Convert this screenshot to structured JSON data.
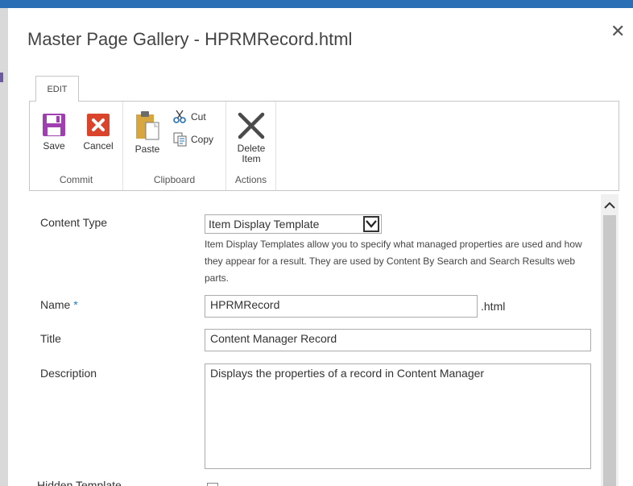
{
  "dialog": {
    "title": "Master Page Gallery - HPRMRecord.html",
    "close_glyph": "✕"
  },
  "ribbon": {
    "tab": "EDIT",
    "groups": {
      "commit": {
        "label": "Commit",
        "save": "Save",
        "cancel": "Cancel"
      },
      "clipboard": {
        "label": "Clipboard",
        "paste": "Paste",
        "cut": "Cut",
        "copy": "Copy"
      },
      "actions": {
        "label": "Actions",
        "delete_line1": "Delete",
        "delete_line2": "Item"
      }
    },
    "icons": {
      "save": "save-icon",
      "cancel": "cancel-icon",
      "paste": "paste-icon",
      "cut": "scissors-icon",
      "copy": "copy-icon",
      "delete": "delete-x-icon"
    },
    "colors": {
      "save": "#a040b0",
      "cancel": "#d9442b",
      "paste": "#d8a63e",
      "delete": "#4a4a4a"
    }
  },
  "form": {
    "content_type": {
      "label": "Content Type",
      "value": "Item Display Template",
      "help": "Item Display Templates allow you to specify what managed properties are used and how they appear for a result.  They are used by Content By Search and Search Results web parts."
    },
    "name": {
      "label": "Name",
      "required_marker": "*",
      "value": "HPRMRecord",
      "suffix": ".html"
    },
    "title": {
      "label": "Title",
      "value": "Content Manager Record"
    },
    "description": {
      "label": "Description",
      "value": "Displays the properties of a record in Content Manager"
    },
    "hidden_template": {
      "label": "Hidden Template"
    }
  },
  "colors": {
    "accent": "#1f7ec8",
    "topbar": "#2a6eb6"
  }
}
